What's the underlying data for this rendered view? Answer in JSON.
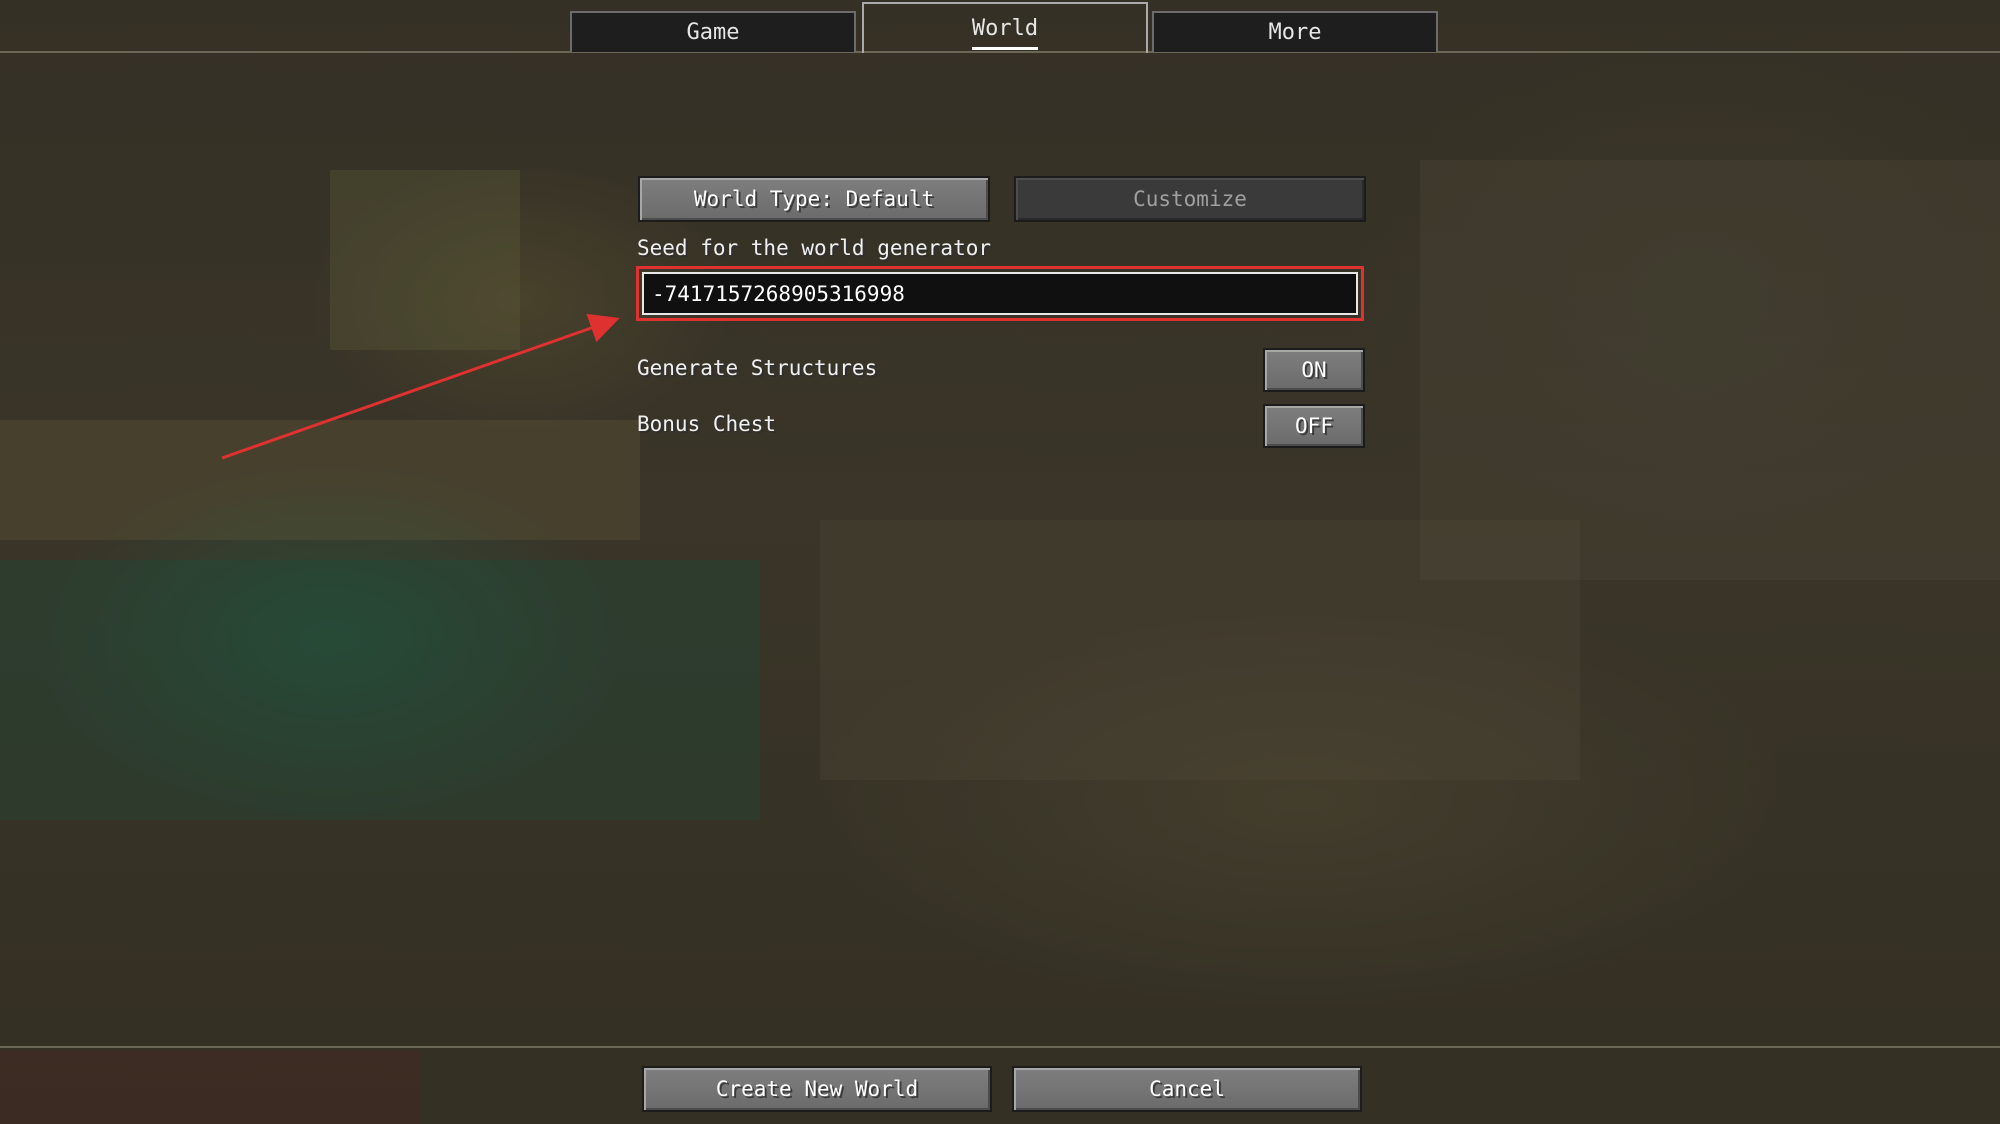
{
  "tabs": [
    {
      "label": "Game"
    },
    {
      "label": "World"
    },
    {
      "label": "More"
    }
  ],
  "active_tab": "World",
  "world_type_button": "World Type: Default",
  "customize_button": "Customize",
  "seed": {
    "label": "Seed for the world generator",
    "value": "-7417157268905316998"
  },
  "options": [
    {
      "label": "Generate Structures",
      "value": "ON"
    },
    {
      "label": "Bonus Chest",
      "value": "OFF"
    }
  ],
  "footer": {
    "create": "Create New World",
    "cancel": "Cancel"
  },
  "colors": {
    "annotation": "#e03131"
  }
}
